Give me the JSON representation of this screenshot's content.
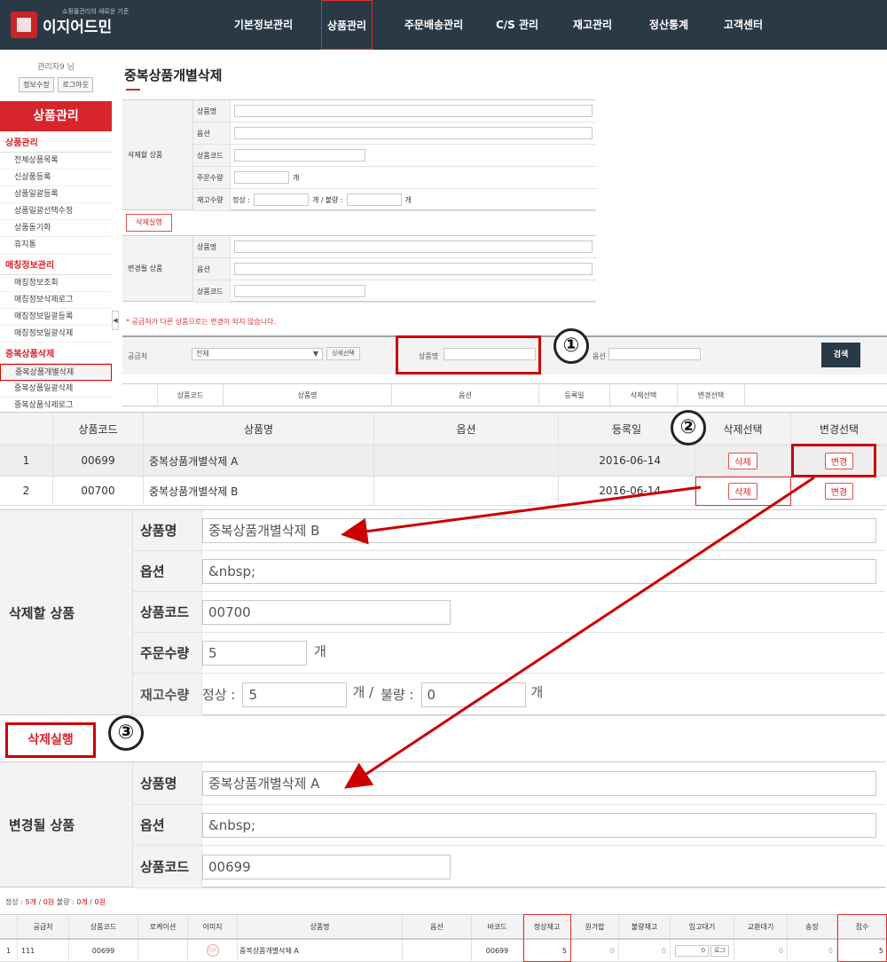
{
  "header": {
    "logo": "이지어드민",
    "tagline": "쇼핑몰관리의 새로운 기준",
    "nav": [
      "기본정보관리",
      "상품관리",
      "주문배송관리",
      "C/S 관리",
      "재고관리",
      "정산통계",
      "고객센터"
    ]
  },
  "sidebar": {
    "admin": "관리자9 님",
    "btn_info": "정보수정",
    "btn_logout": "로그아웃",
    "title": "상품관리",
    "groups": [
      {
        "title": "상품관리",
        "items": [
          "전체상품목록",
          "신상품등록",
          "상품일괄등록",
          "상품일괄선택수정",
          "상품동기화",
          "휴지통"
        ]
      },
      {
        "title": "매칭정보관리",
        "items": [
          "매칭정보조회",
          "매칭정보삭제로그",
          "매칭정보일괄등록",
          "매칭정보일괄삭제"
        ]
      },
      {
        "title": "중복상품삭제",
        "items": [
          "중복상품개별삭제",
          "중복상품일괄삭제",
          "중복상품삭제로그"
        ]
      }
    ],
    "toggle": "◀"
  },
  "page_title": "중복상품개별삭제",
  "small_form": {
    "delete_label": "삭제할 상품",
    "change_label": "변경될 상품",
    "k_name": "상품명",
    "k_option": "옵션",
    "k_code": "상품코드",
    "k_qty": "주문수량",
    "k_stock": "재고수량",
    "unit": "개",
    "normal": "정상 :",
    "unit_slash": "개 /",
    "bad": "불량 :",
    "exec": "삭제실행"
  },
  "note": "* 공급처가 다른 상품으로는 변경이 되지 않습니다.",
  "search": {
    "supplier_label": "공급처",
    "supplier_value": "전체",
    "detail_btn": "상세선택",
    "name_label": "상품명",
    "option_label": "옵션",
    "search_btn": "검색"
  },
  "small_header": [
    "상품코드",
    "상품명",
    "옵션",
    "등록일",
    "삭제선택",
    "변경선택"
  ],
  "result_header": [
    "상품코드",
    "상품명",
    "옵션",
    "등록일",
    "삭제선택",
    "변경선택"
  ],
  "rows": [
    {
      "no": "1",
      "code": "00699",
      "name": "중복상품개별삭제 A",
      "option": "",
      "date": "2016-06-14",
      "del": "삭제",
      "chg": "변경"
    },
    {
      "no": "2",
      "code": "00700",
      "name": "중복상품개별삭제 B",
      "option": "",
      "date": "2016-06-14",
      "del": "삭제",
      "chg": "변경"
    }
  ],
  "big_delete": {
    "label": "삭제할 상품",
    "k_name": "상품명",
    "k_option": "옵션",
    "k_code": "상품코드",
    "k_qty": "주문수량",
    "k_stock": "재고수량",
    "name": "중복상품개별삭제 B",
    "option": "&nbsp;",
    "code": "00700",
    "qty": "5",
    "unit": "개",
    "normal": "정상 :",
    "normal_val": "5",
    "unit_slash": "개 /",
    "bad": "불량 :",
    "bad_val": "0",
    "unit2": "개"
  },
  "exec_btn": "삭제실행",
  "big_change": {
    "label": "변경될 상품",
    "k_name": "상품명",
    "k_option": "옵션",
    "k_code": "상품코드",
    "name": "중복상품개별삭제 A",
    "option": "&nbsp;",
    "code": "00699"
  },
  "summary": {
    "pre": "정상 : ",
    "a": "5개",
    "m1": " / ",
    "b": "0원",
    "m2": " 불량 : ",
    "c": "0개",
    "m3": " / ",
    "d": "0원"
  },
  "bottom_header": [
    "공급처",
    "상품코드",
    "로케이션",
    "이미지",
    "상품명",
    "옵션",
    "바코드",
    "정상재고",
    "원가합",
    "불량재고",
    "입고대기",
    "교환대기",
    "송장",
    "접수"
  ],
  "bottom_row": {
    "no": "1",
    "supplier": "111",
    "code": "00699",
    "loc": "",
    "img": "없음",
    "name": "중복상품개별삭제 A",
    "option": "",
    "barcode": "00699",
    "stock": "5",
    "cost": "0",
    "bad": "0",
    "wait": "0",
    "log": "로그",
    "exch": "0",
    "inv": "0",
    "recv": "5"
  },
  "markers": [
    "①",
    "②",
    "③"
  ],
  "colors": {
    "accent": "#d8242b",
    "topbar": "#2a3946"
  }
}
